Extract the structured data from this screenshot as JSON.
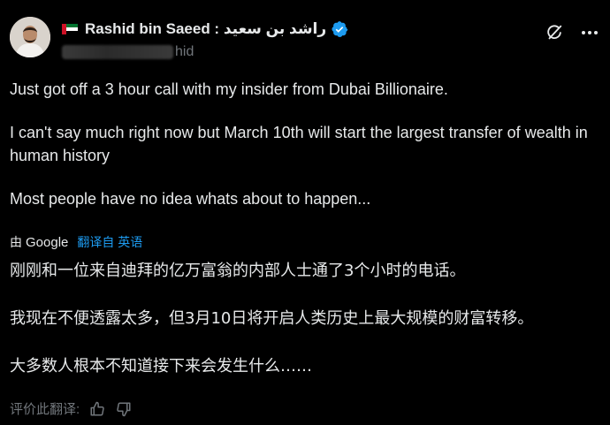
{
  "header": {
    "name": "Rashid bin Saeed : راشد بن سعيد",
    "handle_visible_suffix": "hid"
  },
  "tweet": {
    "lines": [
      "Just got off a 3 hour call with my insider from Dubai Billionaire.",
      "I can't say much right now but March 10th will start the largest transfer of wealth in human history",
      "Most people have no idea whats about to happen..."
    ]
  },
  "translation": {
    "by": "由",
    "provider": "Google",
    "link": "翻译自 英语",
    "lines": [
      "刚刚和一位来自迪拜的亿万富翁的内部人士通了3个小时的电话。",
      "我现在不便透露太多，但3月10日将开启人类历史上最大规模的财富转移。",
      "大多数人根本不知道接下来会发生什么……"
    ]
  },
  "rating": {
    "label": "评价此翻译:"
  },
  "icons": {
    "verified": "verified-badge-icon",
    "grok": "grok-icon",
    "more": "more-icon",
    "thumbs_up": "thumbs-up-icon",
    "thumbs_down": "thumbs-down-icon"
  },
  "colors": {
    "background": "#000000",
    "text": "#e7e9ea",
    "muted": "#71767b",
    "link": "#1d9bf0"
  }
}
